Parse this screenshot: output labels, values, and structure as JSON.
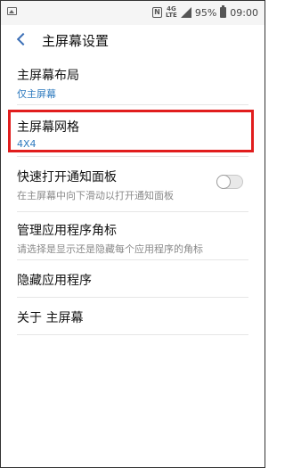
{
  "status_bar": {
    "nfc_icon": "N",
    "network_top": "4G",
    "network_bottom": "LTE",
    "battery": "95%",
    "time": "09:00"
  },
  "header": {
    "title": "主屏幕设置"
  },
  "settings": [
    {
      "title": "主屏幕布局",
      "subtitle": "仅主屏幕",
      "sub_style": "blue"
    },
    {
      "title": "主屏幕网格",
      "subtitle": "4X4",
      "sub_style": "blue",
      "highlighted": true
    },
    {
      "title": "快速打开通知面板",
      "subtitle": "在主屏幕中向下滑动以打开通知面板",
      "sub_style": "gray",
      "toggle": false
    },
    {
      "title": "管理应用程序角标",
      "subtitle": "请选择是显示还是隐藏每个应用程序的角标",
      "sub_style": "gray"
    },
    {
      "title": "隐藏应用程序"
    },
    {
      "title": "关于 主屏幕"
    }
  ],
  "colors": {
    "accent": "#2f7bbf",
    "highlight": "#e11d1d"
  }
}
